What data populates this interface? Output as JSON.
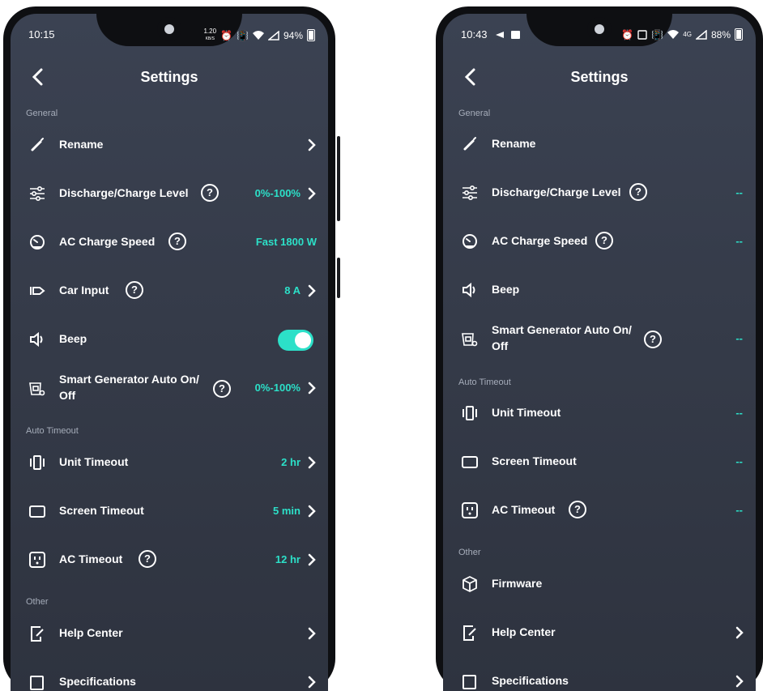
{
  "left_phone": {
    "status": {
      "time": "10:15",
      "net": "1.20",
      "net_unit": "KB/S",
      "signal": "5",
      "battery": "94%"
    },
    "header": {
      "title": "Settings"
    },
    "sections": {
      "general": "General",
      "auto_timeout": "Auto Timeout",
      "other": "Other"
    },
    "rows": {
      "rename": "Rename",
      "discharge": {
        "label": "Discharge/Charge Level",
        "value": "0%-100%"
      },
      "ac_speed": {
        "label": "AC Charge Speed",
        "value": "Fast 1800 W"
      },
      "car_input": {
        "label": "Car Input",
        "value": "8 A"
      },
      "beep": "Beep",
      "generator": {
        "label": "Smart Generator Auto On/ Off",
        "value": "0%-100%"
      },
      "unit_timeout": {
        "label": "Unit Timeout",
        "value": "2 hr"
      },
      "screen_timeout": {
        "label": "Screen Timeout",
        "value": "5 min"
      },
      "ac_timeout": {
        "label": "AC Timeout",
        "value": "12 hr"
      },
      "help_center": "Help Center",
      "specifications": "Specifications"
    }
  },
  "right_phone": {
    "status": {
      "time": "10:43",
      "signal": "4G",
      "battery": "88%"
    },
    "header": {
      "title": "Settings"
    },
    "sections": {
      "general": "General",
      "auto_timeout": "Auto Timeout",
      "other": "Other"
    },
    "rows": {
      "rename": "Rename",
      "discharge": {
        "label": "Discharge/Charge Level",
        "value": "--"
      },
      "ac_speed": {
        "label": "AC Charge Speed",
        "value": "--"
      },
      "beep": "Beep",
      "generator": {
        "label": "Smart Generator Auto On/ Off",
        "value": "--"
      },
      "unit_timeout": {
        "label": "Unit Timeout",
        "value": "--"
      },
      "screen_timeout": {
        "label": "Screen Timeout",
        "value": "--"
      },
      "ac_timeout": {
        "label": "AC Timeout",
        "value": "--"
      },
      "firmware": "Firmware",
      "help_center": "Help Center",
      "specifications": "Specifications"
    }
  },
  "help_glyph": "?",
  "colors": {
    "accent": "#2ce0c8",
    "background_top": "#3b4252",
    "background_bottom": "#2e333f",
    "section_text": "#a6adba"
  },
  "beep_enabled": true
}
